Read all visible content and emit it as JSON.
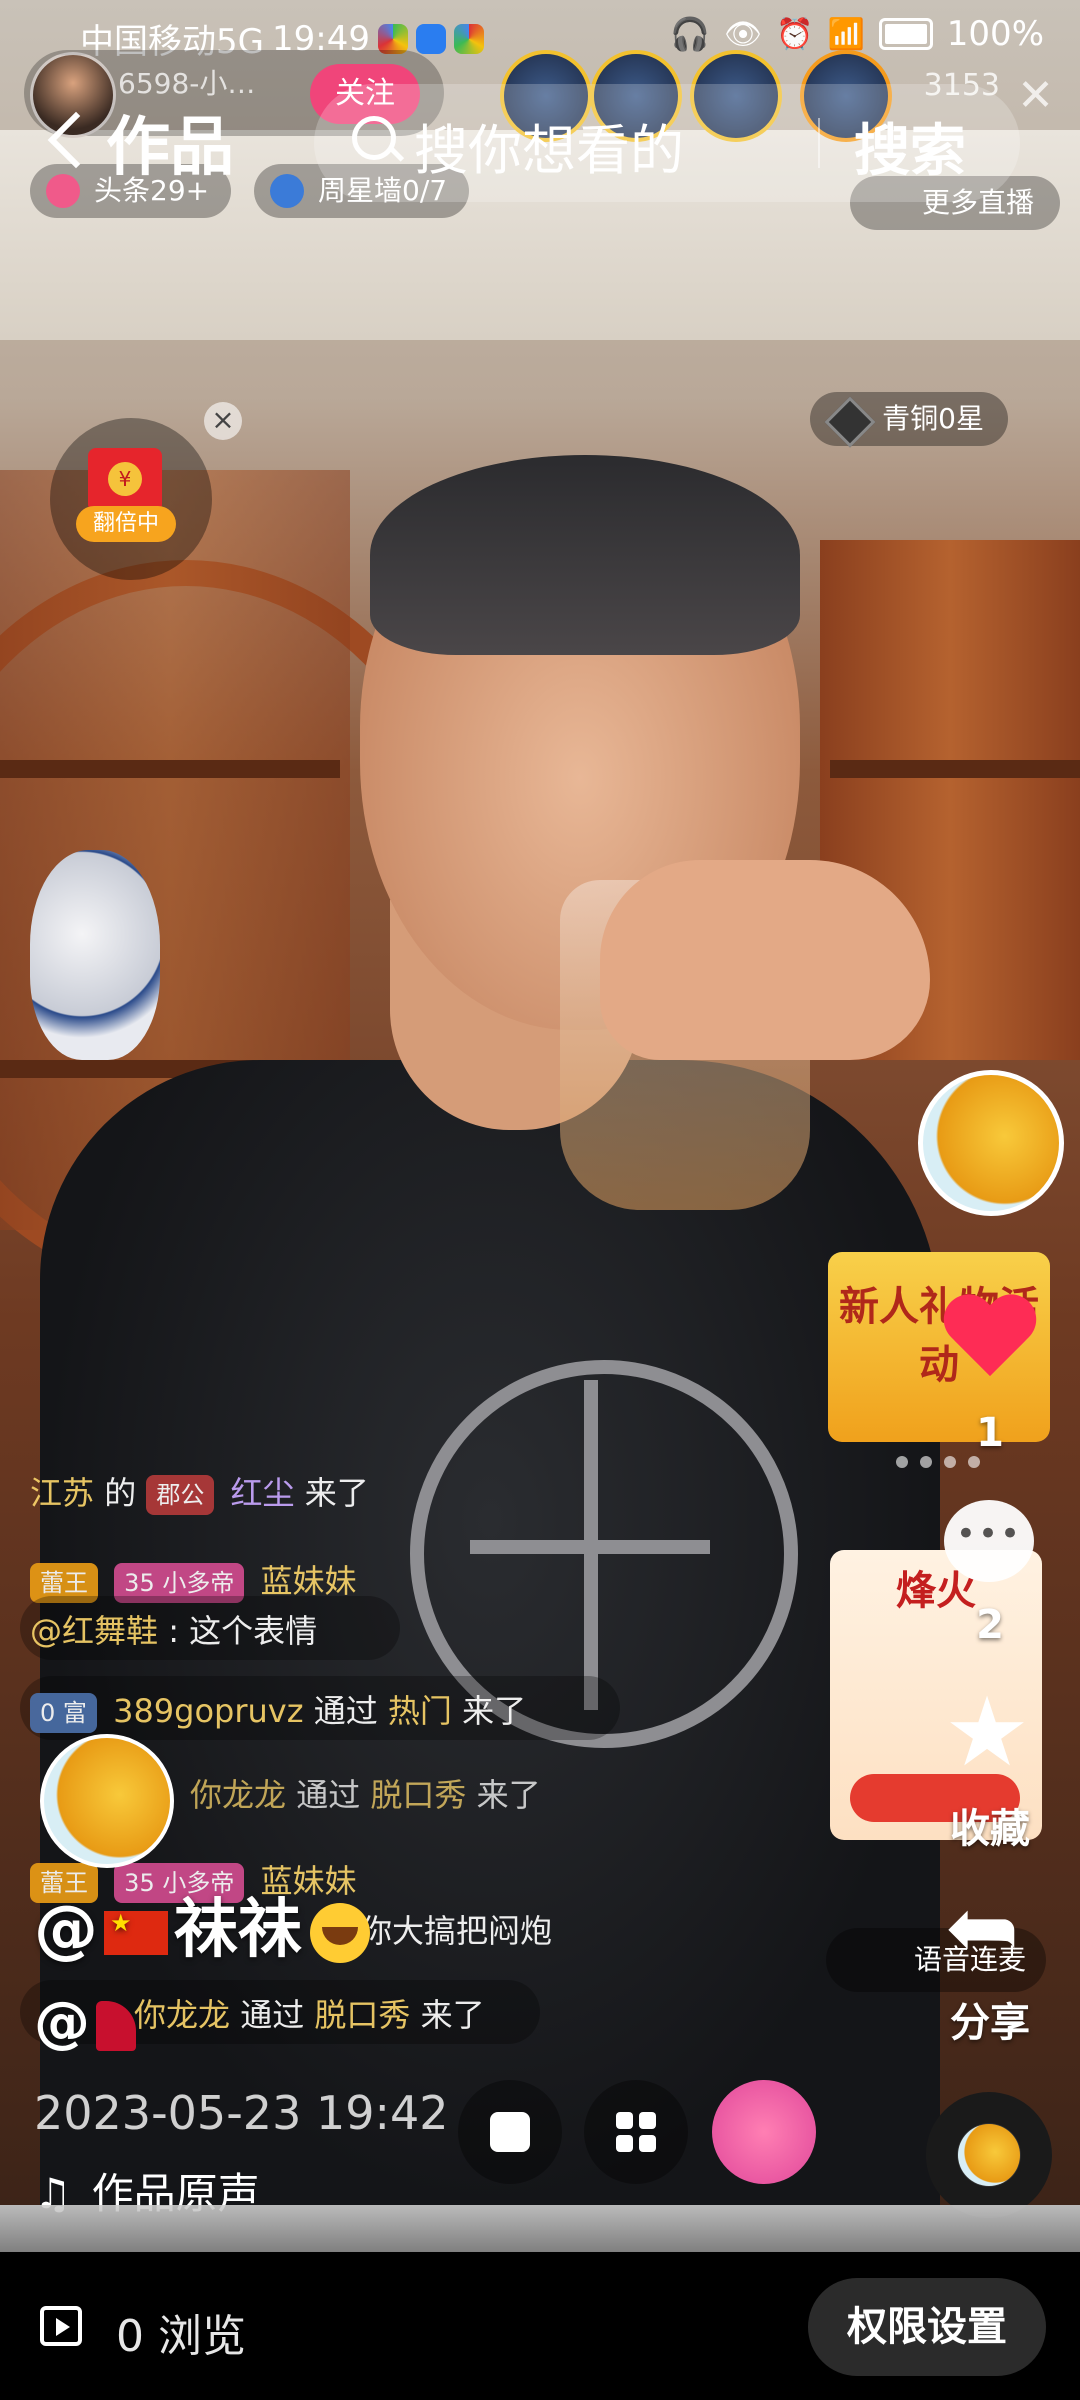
{
  "status_bar": {
    "carrier": "中国移动5G",
    "time": "19:49",
    "battery": "100%"
  },
  "live_overlay": {
    "host_name": "6598-小…",
    "follow_label": "关注",
    "viewer_count": "3153",
    "tags": [
      {
        "label": "头条29+"
      },
      {
        "label": "周星墙0/7"
      }
    ],
    "more_live_label": "更多直播",
    "redpacket_label": "翻倍中",
    "rank_label": "青铜0星",
    "gift_card_title": "新人礼物活动",
    "fire_card": {
      "title": "烽火"
    },
    "voice_chip": "语音连麦"
  },
  "header": {
    "back_label": "",
    "title": "作品",
    "search_placeholder": "搜你想看的",
    "search_button": "搜索"
  },
  "comments": [
    {
      "user": "江苏",
      "text": "的",
      "badge": "郡公",
      "name": "红尘",
      "tail": "来了"
    },
    {
      "badge": "蕾王",
      "lvl": "35 小多帝",
      "name": "蓝妹妹"
    },
    {
      "user": "@红舞鞋",
      "text": ": 这个表情"
    },
    {
      "badge": "0 富",
      "user": "389gopruvz",
      "text": "通过",
      "link": "热门",
      "tail": "来了"
    },
    {
      "user": "你龙龙",
      "text": "通过",
      "link": "脱口秀",
      "tail": "来了"
    },
    {
      "badge": "蕾王",
      "lvl": "35 小多帝",
      "name": "蓝妹妹"
    },
    {
      "text": "你大搞把闷炮"
    },
    {
      "user": "你龙龙",
      "text": "通过",
      "link": "脱口秀",
      "tail": "来了"
    }
  ],
  "actions": {
    "like_count": "1",
    "comment_count": "2",
    "favorite_label": "收藏",
    "share_label": "分享"
  },
  "post": {
    "nickname": "祙祙",
    "mention_prefix": "@",
    "date": "2023-05-23 19:42",
    "music_label": "作品原声"
  },
  "bottom_bar": {
    "views": "0 浏览",
    "permission_button": "权限设置"
  }
}
